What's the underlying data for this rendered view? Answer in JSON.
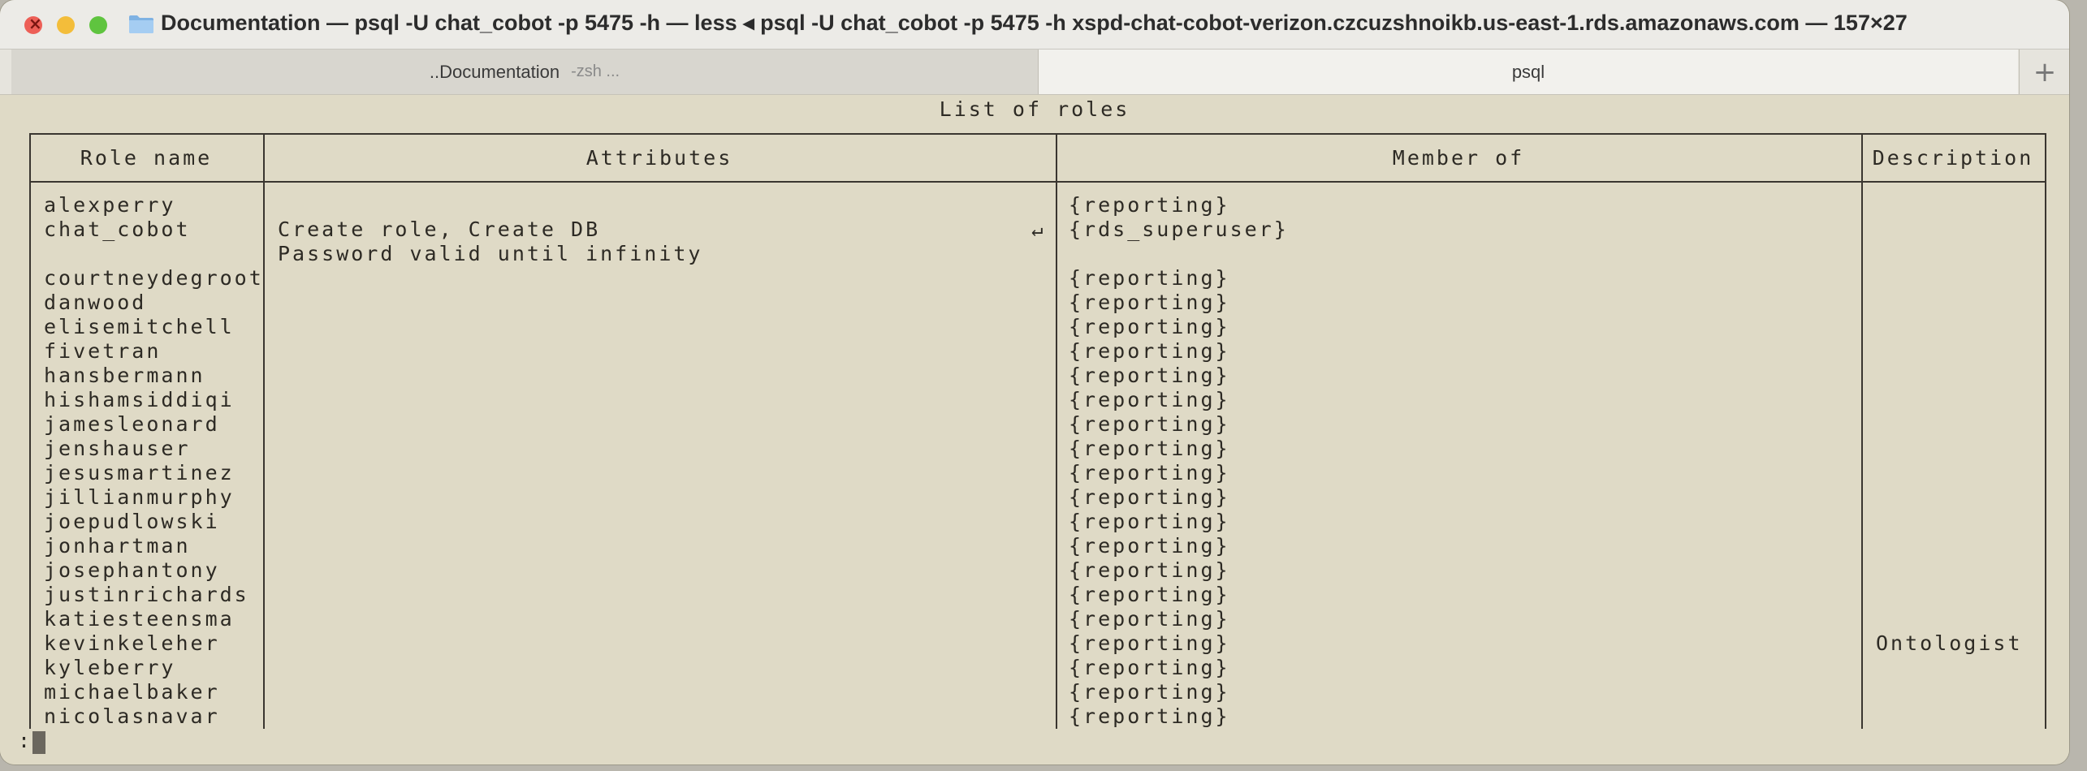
{
  "window": {
    "title": "Documentation — psql -U chat_cobot -p 5475 -h  — less ◂ psql -U chat_cobot -p 5475 -h xspd-chat-cobot-verizon.czcuzshnoikb.us-east-1.rds.amazonaws.com — 157×27"
  },
  "tabs": [
    {
      "label": "..Documentation",
      "sub": "-zsh ..."
    },
    {
      "label": "psql",
      "sub": ""
    }
  ],
  "table": {
    "title": "List of roles",
    "columns": [
      "Role name",
      "Attributes",
      "Member of",
      "Description"
    ],
    "rows": [
      {
        "role": "alexperry",
        "attributes": "",
        "member_of": "{reporting}",
        "description": ""
      },
      {
        "role": "chat_cobot",
        "attributes": "Create role, Create DB",
        "member_of": "{rds_superuser}",
        "description": "",
        "wrap": "↵"
      },
      {
        "role": "",
        "attributes": "Password valid until infinity",
        "member_of": "",
        "description": ""
      },
      {
        "role": "courtneydegroot",
        "attributes": "",
        "member_of": "{reporting}",
        "description": ""
      },
      {
        "role": "danwood",
        "attributes": "",
        "member_of": "{reporting}",
        "description": ""
      },
      {
        "role": "elisemitchell",
        "attributes": "",
        "member_of": "{reporting}",
        "description": ""
      },
      {
        "role": "fivetran",
        "attributes": "",
        "member_of": "{reporting}",
        "description": ""
      },
      {
        "role": "hansbermann",
        "attributes": "",
        "member_of": "{reporting}",
        "description": ""
      },
      {
        "role": "hishamsiddiqi",
        "attributes": "",
        "member_of": "{reporting}",
        "description": ""
      },
      {
        "role": "jamesleonard",
        "attributes": "",
        "member_of": "{reporting}",
        "description": ""
      },
      {
        "role": "jenshauser",
        "attributes": "",
        "member_of": "{reporting}",
        "description": ""
      },
      {
        "role": "jesusmartinez",
        "attributes": "",
        "member_of": "{reporting}",
        "description": ""
      },
      {
        "role": "jillianmurphy",
        "attributes": "",
        "member_of": "{reporting}",
        "description": ""
      },
      {
        "role": "joepudlowski",
        "attributes": "",
        "member_of": "{reporting}",
        "description": ""
      },
      {
        "role": "jonhartman",
        "attributes": "",
        "member_of": "{reporting}",
        "description": ""
      },
      {
        "role": "josephantony",
        "attributes": "",
        "member_of": "{reporting}",
        "description": ""
      },
      {
        "role": "justinrichards",
        "attributes": "",
        "member_of": "{reporting}",
        "description": ""
      },
      {
        "role": "katiesteensma",
        "attributes": "",
        "member_of": "{reporting}",
        "description": ""
      },
      {
        "role": "kevinkeleher",
        "attributes": "",
        "member_of": "{reporting}",
        "description": "Ontologist"
      },
      {
        "role": "kyleberry",
        "attributes": "",
        "member_of": "{reporting}",
        "description": ""
      },
      {
        "role": "michaelbaker",
        "attributes": "",
        "member_of": "{reporting}",
        "description": ""
      },
      {
        "role": "nicolasnavar",
        "attributes": "",
        "member_of": "{reporting}",
        "description": ""
      }
    ]
  },
  "pager": {
    "prompt": ":"
  },
  "colors": {
    "terminal_bg": "#dfdac6",
    "text": "#2d2a24"
  }
}
